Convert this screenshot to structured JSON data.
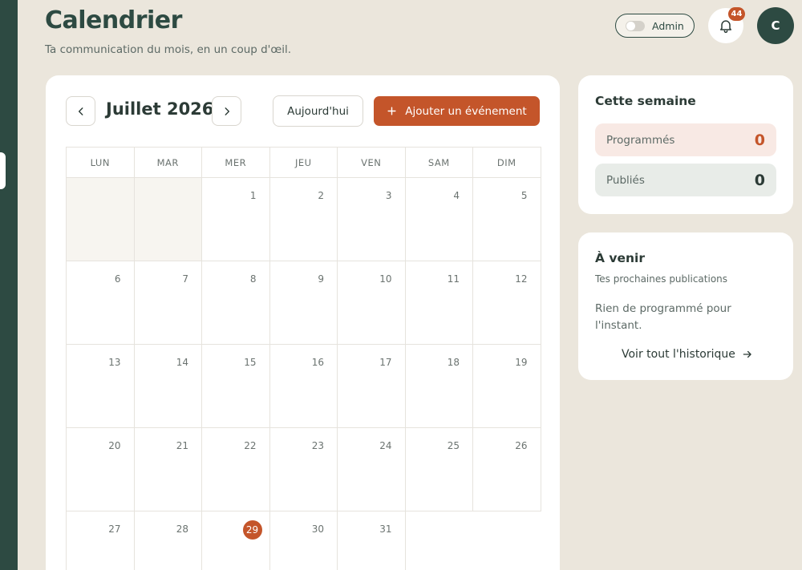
{
  "header": {
    "title": "Calendrier",
    "subtitle": "Ta communication du mois, en un coup d'œil.",
    "admin_label": "Admin",
    "notifications_count": "44",
    "avatar_initial": "C"
  },
  "calendar": {
    "month_label": "Juillet 2026",
    "today_label": "Aujourd'hui",
    "add_event_label": "Ajouter un événement",
    "weekdays": [
      "LUN",
      "MAR",
      "MER",
      "JEU",
      "VEN",
      "SAM",
      "DIM"
    ],
    "days": [
      "1",
      "2",
      "3",
      "4",
      "5",
      "6",
      "7",
      "8",
      "9",
      "10",
      "11",
      "12",
      "13",
      "14",
      "15",
      "16",
      "17",
      "18",
      "19",
      "20",
      "21",
      "22",
      "23",
      "24",
      "25",
      "26",
      "27",
      "28",
      "29",
      "30",
      "31"
    ],
    "today": "29"
  },
  "week": {
    "title": "Cette semaine",
    "scheduled_label": "Programmés",
    "scheduled_value": "0",
    "published_label": "Publiés",
    "published_value": "0"
  },
  "upcoming": {
    "title": "À venir",
    "subtitle": "Tes prochaines publications",
    "empty_text": "Rien de programmé pour l'instant.",
    "history_link": "Voir tout l'historique"
  },
  "colors": {
    "accent": "#c4552a",
    "primary": "#2d4a42",
    "background": "#ebe6dc"
  }
}
